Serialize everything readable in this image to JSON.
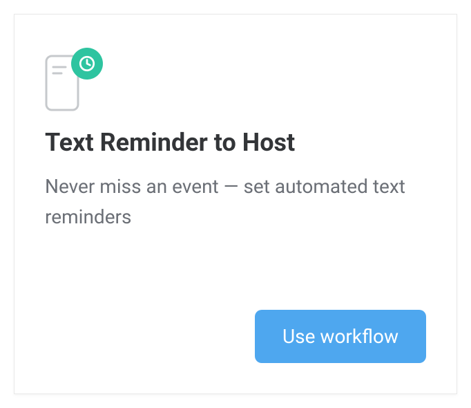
{
  "card": {
    "title": "Text Reminder to Host",
    "description": "Never miss an event — set automated text reminders",
    "button_label": "Use workflow",
    "icon": {
      "phone": "phone-icon",
      "badge": "clock-icon",
      "badge_bg": "#2ec4a0"
    },
    "button_bg": "#4ea7ef"
  }
}
